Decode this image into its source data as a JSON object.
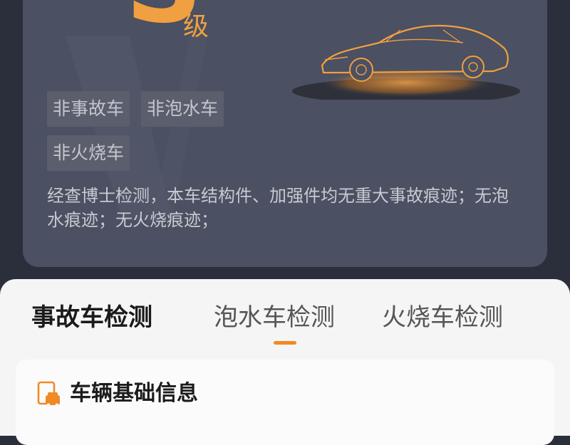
{
  "report": {
    "grade_letter": "S",
    "grade_suffix": "级",
    "car_illustration_icon": "car-outline-icon",
    "tags": [
      "非事故车",
      "非泡水车",
      "非火烧车"
    ],
    "description": "经查博士检测，本车结构件、加强件均无重大事故痕迹；无泡水痕迹；无火烧痕迹；"
  },
  "tabs": [
    {
      "label": "事故车检测",
      "active": true
    },
    {
      "label": "泡水车检测",
      "active": false
    },
    {
      "label": "火烧车检测",
      "active": false
    }
  ],
  "section": {
    "icon": "car-document-icon",
    "title": "车辆基础信息"
  },
  "colors": {
    "accent": "#f08a24",
    "grade": "#f0a040",
    "card_bg": "#4b5062",
    "page_bg": "#2b2e3b",
    "sheet_bg": "#f5f5f5"
  }
}
